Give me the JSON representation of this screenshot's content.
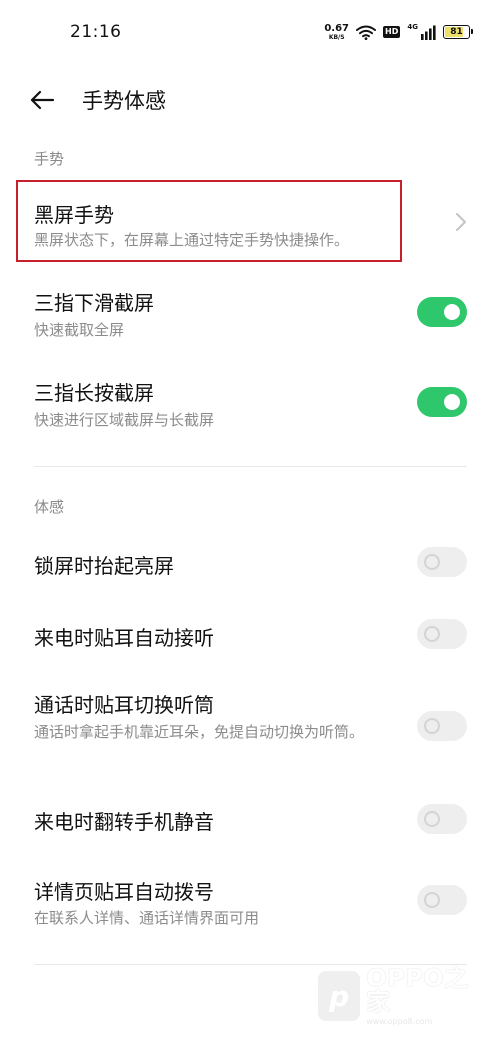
{
  "status": {
    "time": "21:16",
    "net_speed": "0.67",
    "net_unit": "KB/S",
    "hd": "HD",
    "signal_label": "4G",
    "battery": "81",
    "battery_level": 0.81,
    "battery_color": "#ecdf6a",
    "icons": [
      "wifi-icon",
      "hd-icon",
      "cellular-signal-icon",
      "battery-icon"
    ]
  },
  "header": {
    "back_icon": "arrow-left-icon",
    "title": "手势体感"
  },
  "sections": {
    "gestures_label": "手势",
    "motion_label": "体感"
  },
  "gestures": {
    "black_screen": {
      "title": "黑屏手势",
      "subtitle": "黑屏状态下，在屏幕上通过特定手势快捷操作。",
      "icon": "chevron-right-icon"
    },
    "three_finger_swipe": {
      "title": "三指下滑截屏",
      "subtitle": "快速截取全屏",
      "enabled": true
    },
    "three_finger_hold": {
      "title": "三指长按截屏",
      "subtitle": "快速进行区域截屏与长截屏",
      "enabled": true
    }
  },
  "motion": {
    "raise_to_wake": {
      "title": "锁屏时抬起亮屏",
      "enabled": false
    },
    "auto_answer": {
      "title": "来电时贴耳自动接听",
      "enabled": false
    },
    "switch_earpiece": {
      "title": "通话时贴耳切换听筒",
      "subtitle": "通话时拿起手机靠近耳朵，免提自动切换为听筒。",
      "enabled": false
    },
    "flip_to_mute": {
      "title": "来电时翻转手机静音",
      "enabled": false
    },
    "auto_dial": {
      "title": "详情页贴耳自动拨号",
      "subtitle": "在联系人详情、通话详情界面可用",
      "enabled": false
    }
  },
  "watermark": {
    "badge": "p",
    "text": "OPPO之家",
    "url": "www.oppo8.com"
  },
  "colors": {
    "toggle_on": "#2fc76c",
    "toggle_off": "#eeeeee",
    "highlight_border": "#c8202a",
    "secondary_text": "#8c8c8c"
  }
}
